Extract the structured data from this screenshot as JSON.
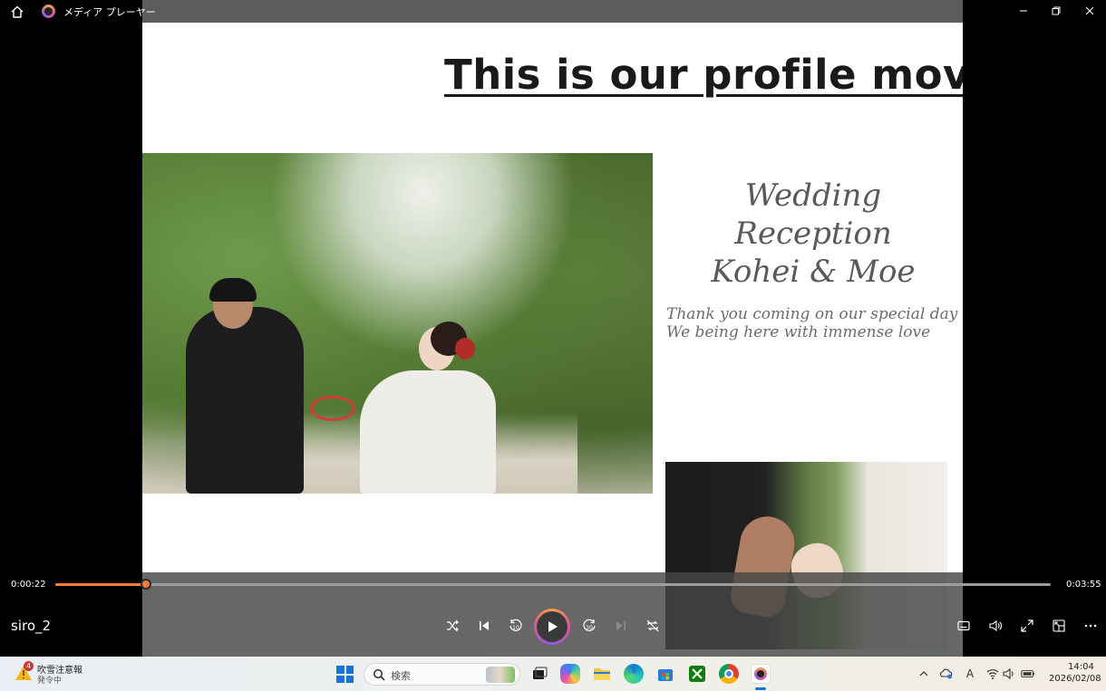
{
  "app": {
    "title": "メディア プレーヤー"
  },
  "video": {
    "slide_title": "This is our profile movie",
    "script_line1": "Wedding Reception",
    "script_line2": "Kohei & Moe",
    "message_line1": "Thank you coming on our special day",
    "message_line2": "We being here with immense love"
  },
  "player": {
    "current_time": "0:00:22",
    "total_time": "0:03:55",
    "progress_fraction": 0.0909,
    "media_title": "siro_2",
    "accent_color": "#f57c3a",
    "buttons": {
      "shuffle": "shuffle-icon",
      "previous": "previous-icon",
      "rewind_10": "rewind-10-icon",
      "play": "play-icon",
      "forward_30": "forward-30-icon",
      "next": "next-icon",
      "repeat_off": "repeat-off-icon",
      "captions": "captions-icon",
      "volume": "volume-icon",
      "fullscreen": "fullscreen-icon",
      "miniplayer": "miniplayer-icon",
      "more": "more-icon"
    }
  },
  "taskbar": {
    "weather_badge": "4",
    "weather_title": "吹雪注意報",
    "weather_status": "発令中",
    "search_label": "検索",
    "ime_label": "A",
    "clock_time": "14:04",
    "clock_date": "2026/02/08"
  }
}
